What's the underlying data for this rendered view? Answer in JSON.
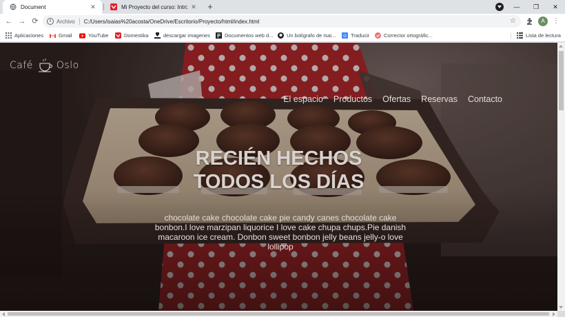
{
  "browser": {
    "tabs": [
      {
        "title": "Document",
        "active": true
      },
      {
        "title": "Mi Proyecto del curso: Introducc",
        "active": false
      }
    ],
    "new_tab_symbol": "+",
    "window_controls": {
      "minimize": "—",
      "maximize": "❐",
      "close": "✕"
    },
    "toolbar": {
      "back_symbol": "←",
      "forward_symbol": "→",
      "reload_symbol": "⟳",
      "info_symbol": "i",
      "scheme_chip": "Archivo",
      "url": "C:/Users/isaias%20acosta/OneDrive/Escritorio/Proyecto/html/index.html",
      "star_symbol": "☆",
      "profile_initial": "A",
      "menu_symbol": "⋮"
    },
    "bookmarks": [
      {
        "label": "Aplicaciones",
        "icon": "apps-grid-icon",
        "color": "#5f6368"
      },
      {
        "label": "Gmail",
        "icon": "gmail-icon",
        "color": "#ea4335"
      },
      {
        "label": "YouTube",
        "icon": "youtube-icon",
        "color": "#ff0000"
      },
      {
        "label": "Domestika",
        "icon": "domestika-icon",
        "color": "#e91e63"
      },
      {
        "label": "descargar imagenes",
        "icon": "download-icon",
        "color": "#202124"
      },
      {
        "label": "Documentos web d...",
        "icon": "document-icon",
        "color": "#202124"
      },
      {
        "label": "Un bolígrafo de Isai...",
        "icon": "github-icon",
        "color": "#202124"
      },
      {
        "label": "Traducir",
        "icon": "translate-icon",
        "color": "#4285f4"
      },
      {
        "label": "Corrector ortográfic...",
        "icon": "spellcheck-icon",
        "color": "#e57373"
      }
    ],
    "reading_list": {
      "label": "Lista de lectura",
      "icon": "reading-list-icon"
    }
  },
  "page": {
    "logo": {
      "left": "Café",
      "right": "Oslo"
    },
    "nav": [
      "El espacio",
      "Productos",
      "Ofertas",
      "Reservas",
      "Contacto"
    ],
    "hero": {
      "title_line1": "RECIÉN HECHOS",
      "title_line2": "TODOS LOS DÍAS",
      "text": "chocolate cake chocolate cake pie candy canes chocolate cake bonbon.I love marzipan liquorice I love cake chupa chups.Pie danish macaroon ice cream. Donbon sweet bonbon jelly beans jelly-o love lollipop"
    },
    "colors": {
      "dress_red": "#b8282a",
      "muffin_brown": "#4a2a1f",
      "tray_cream": "#cdb9a0"
    }
  }
}
